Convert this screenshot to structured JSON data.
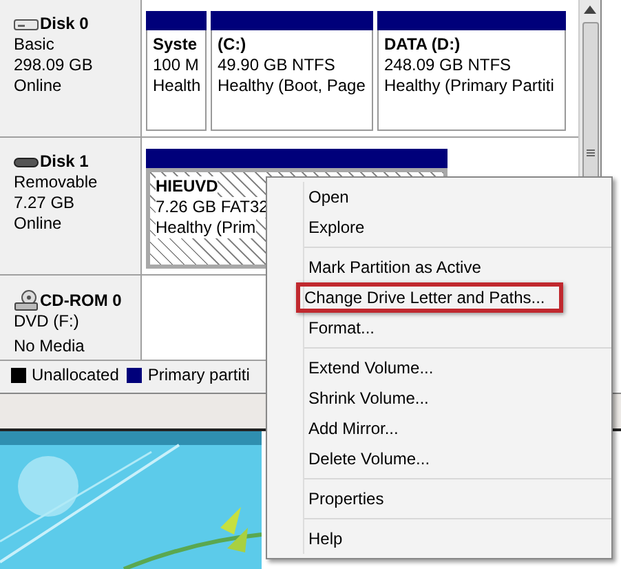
{
  "disks": [
    {
      "name": "Disk 0",
      "kind": "hdd",
      "lines": [
        "Basic",
        "298.09 GB",
        "Online"
      ],
      "partitions": [
        {
          "name": "Syste",
          "lines": [
            "100 M",
            "Health"
          ],
          "selected": false,
          "hatched": false
        },
        {
          "name": "(C:)",
          "lines": [
            "49.90 GB NTFS",
            "Healthy (Boot, Page"
          ],
          "selected": false,
          "hatched": false
        },
        {
          "name": "DATA  (D:)",
          "lines": [
            "248.09 GB NTFS",
            "Healthy (Primary Partiti"
          ],
          "selected": false,
          "hatched": false
        }
      ]
    },
    {
      "name": "Disk 1",
      "kind": "removable",
      "lines": [
        "Removable",
        "7.27 GB",
        "Online"
      ],
      "partitions": [
        {
          "name": "HIEUVD",
          "lines": [
            "7.26 GB FAT32",
            "Healthy (Prim"
          ],
          "selected": true,
          "hatched": true
        }
      ]
    },
    {
      "name": "CD-ROM 0",
      "kind": "cdrom",
      "lines": [
        "DVD (F:)",
        "No Media"
      ]
    }
  ],
  "legend": [
    {
      "label": "Unallocated",
      "color": "#000000"
    },
    {
      "label": "Primary partiti",
      "color": "#00007a"
    }
  ],
  "context_menu": {
    "groups": [
      [
        {
          "label": "Open",
          "highlighted": false
        },
        {
          "label": "Explore",
          "highlighted": false
        }
      ],
      [
        {
          "label": "Mark Partition as Active",
          "highlighted": false
        },
        {
          "label": "Change Drive Letter and Paths...",
          "highlighted": true
        },
        {
          "label": "Format...",
          "highlighted": false
        }
      ],
      [
        {
          "label": "Extend Volume...",
          "highlighted": false
        },
        {
          "label": "Shrink Volume...",
          "highlighted": false
        },
        {
          "label": "Add Mirror...",
          "highlighted": false
        },
        {
          "label": "Delete Volume...",
          "highlighted": false
        }
      ],
      [
        {
          "label": "Properties",
          "highlighted": false
        }
      ],
      [
        {
          "label": "Help",
          "highlighted": false
        }
      ]
    ]
  }
}
